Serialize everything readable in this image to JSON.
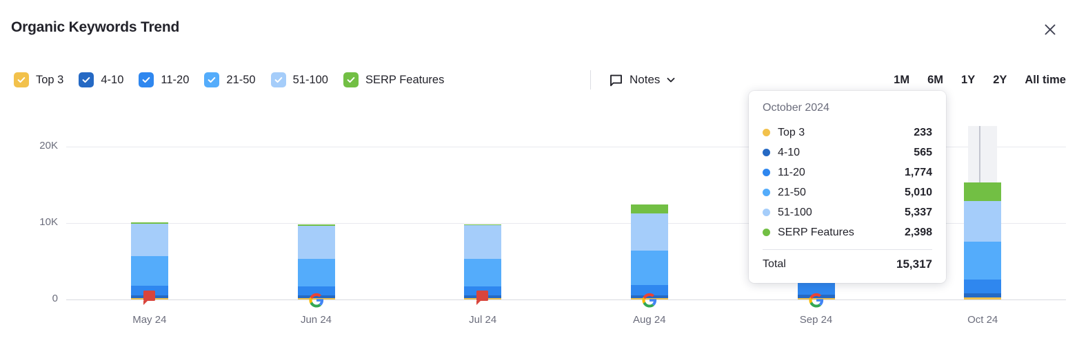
{
  "header": {
    "title": "Organic Keywords Trend",
    "close_label": "×"
  },
  "legend": {
    "items": [
      {
        "label": "Top 3",
        "color": "#f2c14b",
        "checked": true
      },
      {
        "label": "4-10",
        "color": "#2569c4",
        "checked": true
      },
      {
        "label": "11-20",
        "color": "#2f87ef",
        "checked": true
      },
      {
        "label": "21-50",
        "color": "#54acfb",
        "checked": true
      },
      {
        "label": "51-100",
        "color": "#a5cdfa",
        "checked": true
      },
      {
        "label": "SERP Features",
        "color": "#72bf44",
        "checked": true
      }
    ]
  },
  "notes": {
    "label": "Notes"
  },
  "ranges": {
    "options": [
      "1M",
      "6M",
      "1Y",
      "2Y",
      "All time"
    ],
    "selected": "All time"
  },
  "tooltip": {
    "title": "October 2024",
    "rows": [
      {
        "label": "Top 3",
        "value": "233",
        "color": "#f2c14b"
      },
      {
        "label": "4-10",
        "value": "565",
        "color": "#2569c4"
      },
      {
        "label": "11-20",
        "value": "1,774",
        "color": "#2f87ef"
      },
      {
        "label": "21-50",
        "value": "5,010",
        "color": "#54acfb"
      },
      {
        "label": "51-100",
        "value": "5,337",
        "color": "#a5cdfa"
      },
      {
        "label": "SERP Features",
        "value": "2,398",
        "color": "#72bf44"
      }
    ],
    "total_label": "Total",
    "total_value": "15,317"
  },
  "chart_data": {
    "type": "bar",
    "title": "Organic Keywords Trend",
    "stacked": true,
    "xlabel": "",
    "ylabel": "",
    "ylim": [
      0,
      22000
    ],
    "yticks": [
      0,
      10000,
      20000
    ],
    "ytick_labels": [
      "0",
      "10K",
      "20K"
    ],
    "grid": true,
    "legend_position": "top",
    "categories": [
      "May 24",
      "Jun 24",
      "Jul 24",
      "Aug 24",
      "Sep 24",
      "Oct 24"
    ],
    "series": [
      {
        "name": "Top 3",
        "color": "#f2c14b",
        "values": [
          150,
          150,
          150,
          160,
          190,
          233
        ]
      },
      {
        "name": "4-10",
        "color": "#2569c4",
        "values": [
          400,
          400,
          400,
          420,
          480,
          565
        ]
      },
      {
        "name": "11-20",
        "color": "#2f87ef",
        "values": [
          1250,
          1200,
          1200,
          1300,
          1500,
          1774
        ]
      },
      {
        "name": "21-50",
        "color": "#54acfb",
        "values": [
          3850,
          3550,
          3600,
          4550,
          4800,
          5010
        ]
      },
      {
        "name": "51-100",
        "color": "#a5cdfa",
        "values": [
          4250,
          4350,
          4350,
          4850,
          5100,
          5337
        ]
      },
      {
        "name": "SERP Features",
        "color": "#72bf44",
        "values": [
          160,
          130,
          140,
          1150,
          1900,
          2398
        ]
      }
    ],
    "totals": [
      10060,
      9780,
      9840,
      12430,
      13970,
      15317
    ],
    "hovered_category": "Oct 24",
    "annotations": [
      {
        "category": "May 24",
        "type": "google-algorithm-update",
        "icon": "red-flag"
      },
      {
        "category": "Jun 24",
        "type": "google-update",
        "icon": "google-logo"
      },
      {
        "category": "Jul 24",
        "type": "google-algorithm-update",
        "icon": "red-flag"
      },
      {
        "category": "Aug 24",
        "type": "google-update",
        "icon": "google-logo"
      },
      {
        "category": "Sep 24",
        "type": "google-update",
        "icon": "google-logo"
      }
    ]
  }
}
